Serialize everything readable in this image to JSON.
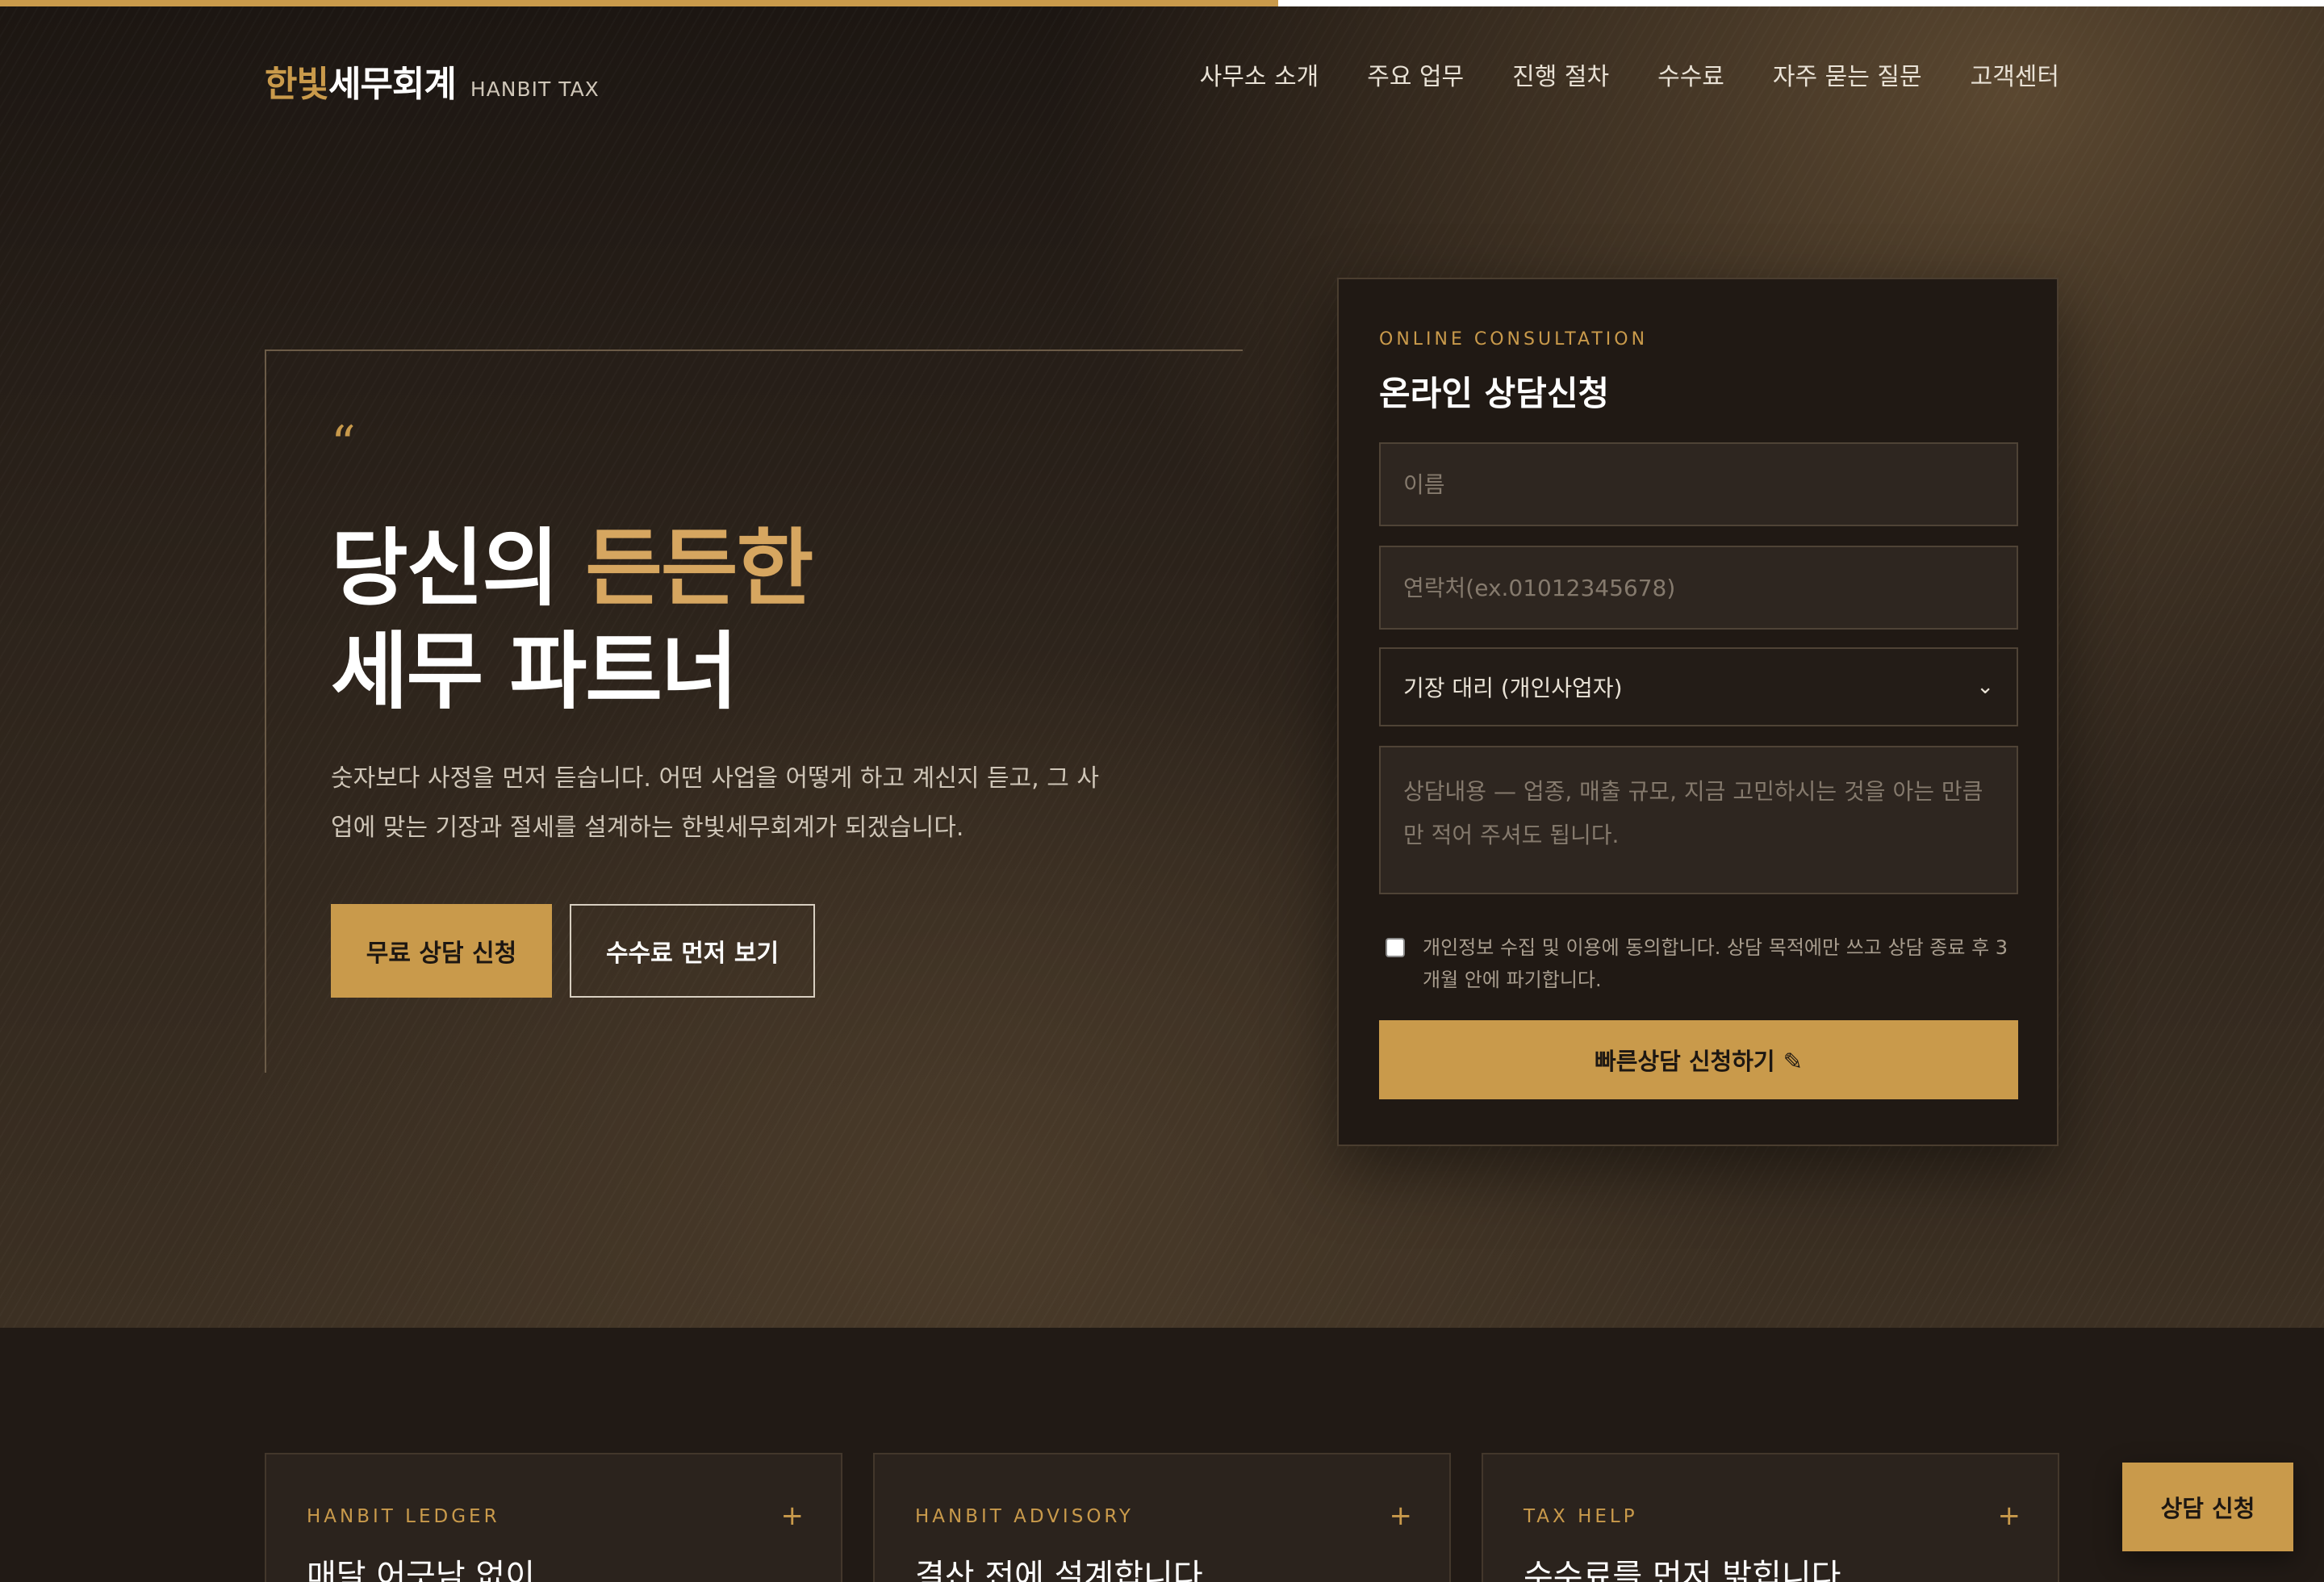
{
  "page": {
    "scroll_progress": 0.55
  },
  "colors": {
    "accent": "#c99a4b",
    "background": "#211a15",
    "panel": "#201914"
  },
  "header": {
    "brand_accent": "한빛",
    "brand_rest": "세무회계",
    "brand_en": "HANBIT TAX",
    "nav": [
      "사무소 소개",
      "주요 업무",
      "진행 절차",
      "수수료",
      "자주 묻는 질문",
      "고객센터"
    ]
  },
  "hero": {
    "quote_mark": "“",
    "title_part1": "당신의 ",
    "title_highlight": "든든한",
    "title_line2": "세무 파트너",
    "description": "숫자보다 사정을 먼저 듣습니다. 어떤 사업을 어떻게 하고 계신지 듣고, 그 사업에 맞는 기장과 절세를 설계하는 한빛세무회계가 되겠습니다.",
    "primary_button": "무료 상담 신청",
    "secondary_button": "수수료 먼저 보기"
  },
  "consult_form": {
    "kicker": "ONLINE CONSULTATION",
    "title": "온라인 상담신청",
    "name_placeholder": "이름",
    "phone_placeholder": "연락처(ex.01012345678)",
    "service_selected": "기장 대리 (개인사업자)",
    "message_placeholder": "상담내용 — 업종, 매출 규모, 지금 고민하시는 것을 아는 만큼만 적어 주셔도 됩니다.",
    "consent_text": "개인정보 수집 및 이용에 동의합니다. 상담 목적에만 쓰고 상담 종료 후 3개월 안에 파기합니다.",
    "consent_checked": false,
    "submit_label": "빠른상담 신청하기 ✎"
  },
  "cards": [
    {
      "kicker": "HANBIT LEDGER",
      "title": "매달 어긋남 없이",
      "icon": "plus-icon"
    },
    {
      "kicker": "HANBIT ADVISORY",
      "title": "결산 전에 설계합니다",
      "icon": "plus-icon"
    },
    {
      "kicker": "TAX HELP",
      "title": "수수료를 먼저 밝힙니다",
      "icon": "plus-icon"
    }
  ],
  "float_cta": "상담 신청"
}
